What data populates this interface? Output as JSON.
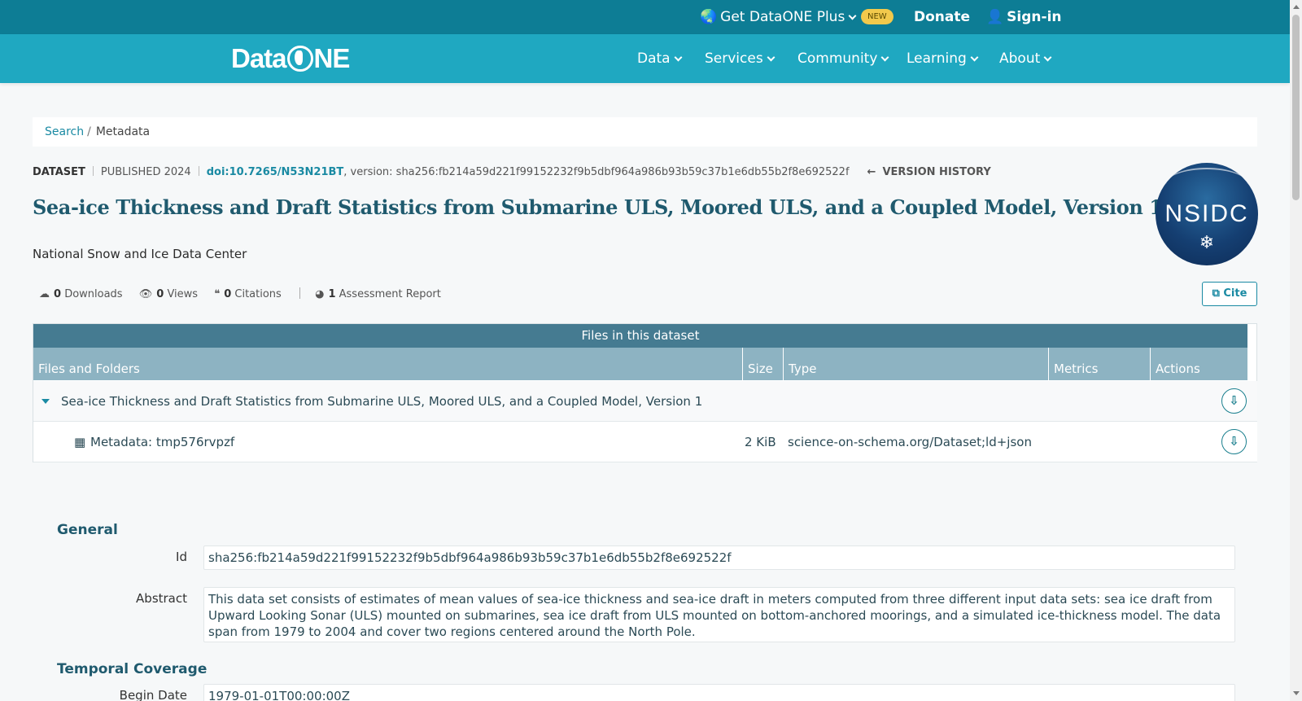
{
  "topbar": {
    "plus_label": "Get DataONE Plus",
    "new_badge": "NEW",
    "donate_label": "Donate",
    "signin_label": "Sign-in"
  },
  "brand": {
    "logo_text_a": "Data",
    "logo_text_b": "NE"
  },
  "nav": {
    "items": [
      {
        "label": "Data"
      },
      {
        "label": "Services"
      },
      {
        "label": "Community"
      },
      {
        "label": "Learning"
      },
      {
        "label": "About"
      }
    ]
  },
  "breadcrumb": {
    "link": "Search",
    "separator": "/",
    "current": "Metadata"
  },
  "dataset": {
    "type": "DATASET",
    "published": "PUBLISHED 2024",
    "doi": "doi:10.7265/N53N21BT",
    "version_text": ", version: sha256:fb214a59d221f99152232f9b5dbf964a986b93b59c37b1e6db55b2f8e692522f",
    "version_history": "VERSION HISTORY",
    "title": "Sea-ice Thickness and Draft Statistics from Submarine ULS, Moored ULS, and a Coupled Model, Version 1",
    "org": "National Snow and Ice Data Center",
    "logo_text": "NSIDC"
  },
  "metrics": {
    "downloads_count": "0",
    "downloads_label": "Downloads",
    "views_count": "0",
    "views_label": "Views",
    "citations_count": "0",
    "citations_label": "Citations",
    "assessment_count": "1",
    "assessment_label": "Assessment Report",
    "cite_label": "Cite"
  },
  "files": {
    "caption": "Files in this dataset",
    "columns": [
      "Files and Folders",
      "Size",
      "Type",
      "Metrics",
      "Actions"
    ],
    "rows": [
      {
        "name": "Sea-ice Thickness and Draft Statistics from Submarine ULS, Moored ULS, and a Coupled Model, Version 1",
        "size": "",
        "type": ""
      },
      {
        "name": "Metadata: tmp576rvpzf",
        "size": "2 KiB",
        "type": "science-on-schema.org/Dataset;ld+json"
      }
    ]
  },
  "general": {
    "heading": "General",
    "id_label": "Id",
    "id_value": "sha256:fb214a59d221f99152232f9b5dbf964a986b93b59c37b1e6db55b2f8e692522f",
    "abstract_label": "Abstract",
    "abstract_value": "This data set consists of estimates of mean values of sea-ice thickness and sea-ice draft in meters computed from three different input data sets: sea ice draft from Upward Looking Sonar (ULS) mounted on submarines, sea ice draft from ULS mounted on bottom-anchored moorings, and a simulated ice-thickness model. The data span from 1979 to 2004 and cover two regions centered around the North Pole."
  },
  "temporal": {
    "heading": "Temporal Coverage",
    "begin_label": "Begin Date",
    "begin_value": "1979-01-01T00:00:00Z"
  }
}
